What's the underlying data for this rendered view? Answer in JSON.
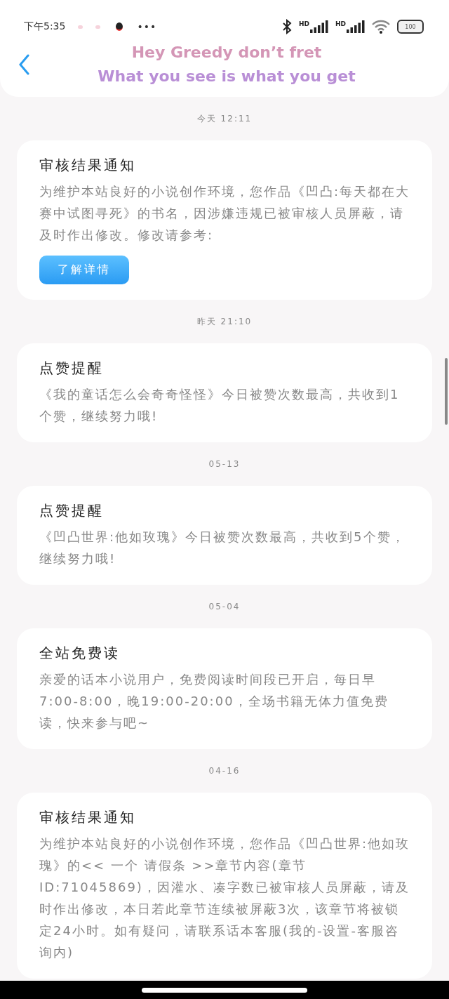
{
  "status_bar": {
    "time": "下午5:35",
    "more": "•••",
    "signal_labels": [
      "HD",
      "HD"
    ],
    "battery": "100"
  },
  "header": {
    "title_lines": [
      "Hey Greedy don’t fret",
      "What you see is what you get"
    ]
  },
  "messages": [
    {
      "date": "今天 12:11",
      "title": "审核结果通知",
      "body": "为维护本站良好的小说创作环境，您作品《凹凸:每天都在大赛中试图寻死》的书名，因涉嫌违规已被审核人员屏蔽，请及时作出修改。修改请参考:",
      "action": "了解详情"
    },
    {
      "date": "昨天 21:10",
      "title": "点赞提醒",
      "body": "《我的童话怎么会奇奇怪怪》今日被赞次数最高，共收到1个赞，继续努力哦!"
    },
    {
      "date": "05-13",
      "title": "点赞提醒",
      "body": "《凹凸世界:他如玫瑰》今日被赞次数最高，共收到5个赞，继续努力哦!"
    },
    {
      "date": "05-04",
      "title": "全站免费读",
      "body": "亲爱的话本小说用户，免费阅读时间段已开启，每日早7:00-8:00，晚19:00-20:00，全场书籍无体力值免费读，快来参与吧~"
    },
    {
      "date": "04-16",
      "title": "审核结果通知",
      "body": "为维护本站良好的小说创作环境，您作品《凹凸世界:他如玫瑰》的<< 一个  请假条 >>章节内容(章节ID:71045869)，因灌水、凑字数已被审核人员屏蔽，请及时作出修改，本日若此章节连续被屏蔽3次，该章节将被锁定24小时。如有疑问，请联系话本客服(我的-设置-客服咨询内)"
    }
  ]
}
